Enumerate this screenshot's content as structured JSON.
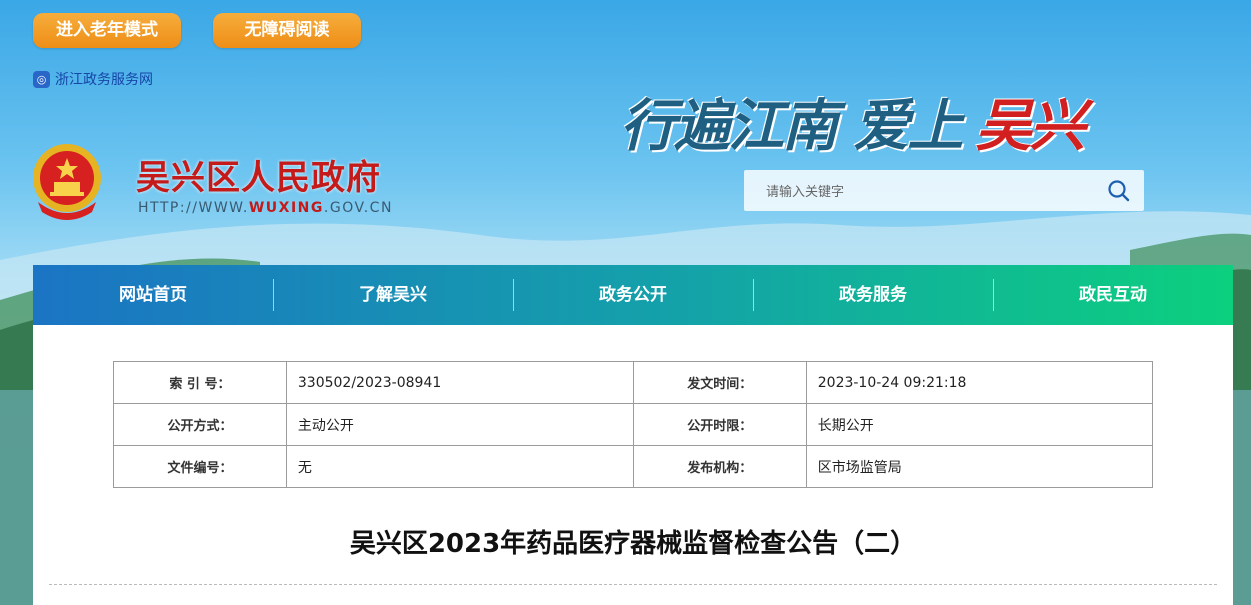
{
  "top_buttons": {
    "elder_mode": "进入老年模式",
    "accessible_reading": "无障碍阅读"
  },
  "zhejiang_link": {
    "icon": "zj-gov-icon",
    "label": "浙江政务服务网"
  },
  "slogan": {
    "part1": "行遍江南 爱上",
    "part2": "吴兴"
  },
  "site": {
    "name": "吴兴区人民政府",
    "url_prefix": "HTTP://WWW.",
    "url_domain": "WUXING",
    "url_suffix": ".GOV.CN"
  },
  "search": {
    "placeholder": "请输入关键字",
    "icon": "search-icon"
  },
  "nav": [
    {
      "label": "网站首页"
    },
    {
      "label": "了解吴兴"
    },
    {
      "label": "政务公开"
    },
    {
      "label": "政务服务"
    },
    {
      "label": "政民互动"
    }
  ],
  "info": {
    "rows": [
      {
        "l1": "索 引 号：",
        "v1": "330502/2023-08941",
        "l2": "发文时间：",
        "v2": "2023-10-24 09:21:18"
      },
      {
        "l1": "公开方式：",
        "v1": "主动公开",
        "l2": "公开时限：",
        "v2": "长期公开"
      },
      {
        "l1": "文件编号：",
        "v1": "无",
        "l2": "发布机构：",
        "v2": "区市场监管局"
      }
    ]
  },
  "article": {
    "title": "吴兴区2023年药品医疗器械监督检查公告（二）"
  },
  "colors": {
    "accent_orange": "#f29a22",
    "brand_red": "#c41a1a",
    "nav_start": "#1b74c4",
    "nav_end": "#0cd07e"
  }
}
